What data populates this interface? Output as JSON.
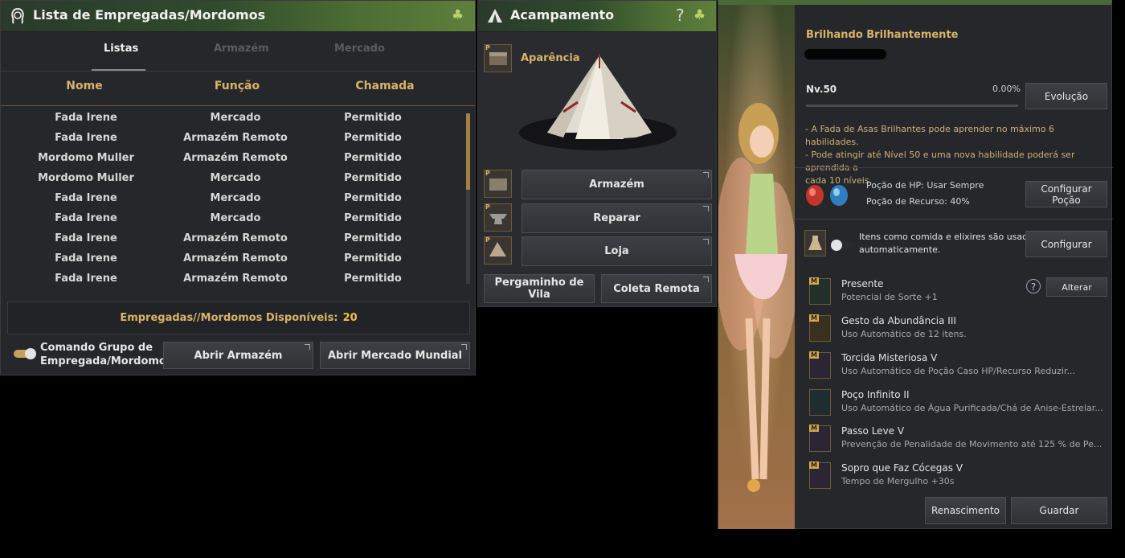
{
  "maid_panel": {
    "title": "Lista de Empregadas/Mordomos",
    "tabs": [
      "Listas",
      "Armazém",
      "Mercado"
    ],
    "columns": [
      "Nome",
      "Função",
      "Chamada"
    ],
    "rows": [
      [
        "Fada Irene",
        "Mercado",
        "Permitido"
      ],
      [
        "Fada Irene",
        "Armazém Remoto",
        "Permitido"
      ],
      [
        "Mordomo Muller",
        "Armazém Remoto",
        "Permitido"
      ],
      [
        "Mordomo Muller",
        "Mercado",
        "Permitido"
      ],
      [
        "Fada Irene",
        "Mercado",
        "Permitido"
      ],
      [
        "Fada Irene",
        "Mercado",
        "Permitido"
      ],
      [
        "Fada Irene",
        "Armazém Remoto",
        "Permitido"
      ],
      [
        "Fada Irene",
        "Armazém Remoto",
        "Permitido"
      ],
      [
        "Fada Irene",
        "Armazém Remoto",
        "Permitido"
      ]
    ],
    "available_label": "Empregadas//Mordomos Disponíveis:",
    "available_count": "20",
    "group_command_label_1": "Comando Grupo de",
    "group_command_label_2": "Empregada/Mordomo",
    "open_storage": "Abrir Armazém",
    "open_market": "Abrir Mercado Mundial"
  },
  "camp_panel": {
    "title": "Acampamento",
    "help": "?",
    "appearance": "Aparência",
    "storage": "Armazém",
    "repair": "Reparar",
    "shop": "Loja",
    "village_scroll": "Pergaminho de Vila",
    "remote_collect": "Coleta Remota"
  },
  "fairy_panel": {
    "name": "Brilhando Brilhantemente",
    "level": "Nv.50",
    "exp_percent": "0.00%",
    "exp_fraction": 0.0,
    "evolve": "Evolução",
    "info_1": "- A Fada de Asas Brilhantes pode aprender no máximo 6 habilidades.",
    "info_2": "- Pode atingir até Nível 50 e uma nova habilidade poderá ser aprendida a",
    "info_3": "cada 10 níveis.",
    "hp_potion": "Poção de HP: Usar Sempre",
    "resource_potion": "Poção de Recurso: 40%",
    "config_potion": "Configurar Poção",
    "auto_items_1": "Itens como comida e elixires são usados",
    "auto_items_2": "automaticamente.",
    "configure": "Configurar",
    "change": "Alterar",
    "skill_badge": "M",
    "skills": [
      {
        "name": "Presente",
        "desc": "Potencial de Sorte +1"
      },
      {
        "name": "Gesto da Abundância III",
        "desc": "Uso Automático de 12 itens."
      },
      {
        "name": "Torcida Misteriosa V",
        "desc": "Uso Automático de Poção Caso HP/Recurso Reduzir..."
      },
      {
        "name": "Poço Infinito II",
        "desc": "Uso Automático de Água Purificada/Chá de Anise-Estrelar..."
      },
      {
        "name": "Passo Leve V",
        "desc": "Prevenção de Penalidade de Movimento até 125 % de Pe..."
      },
      {
        "name": "Sopro que Faz Cócegas V",
        "desc": "Tempo de Mergulho +30s"
      }
    ],
    "rebirth": "Renascimento",
    "store": "Guardar"
  },
  "colors": {
    "gold": "#d8b46a",
    "title_green": "#4d6d34",
    "panel_bg": "#26272a"
  }
}
